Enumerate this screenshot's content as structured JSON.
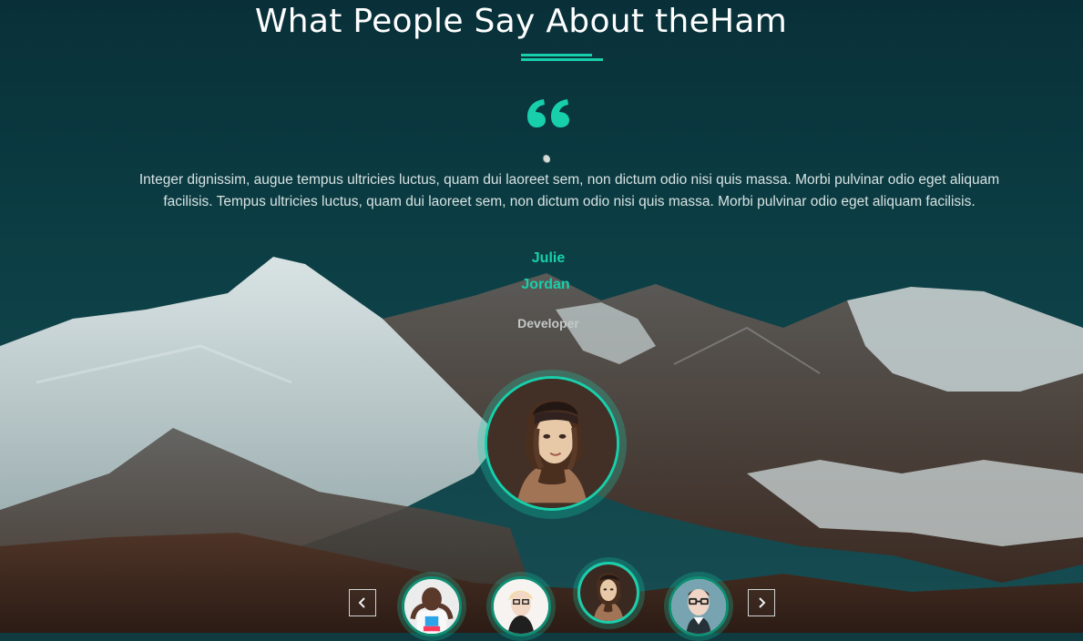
{
  "section": {
    "title": "What People Say About theHam",
    "quote_text_line1": "Integer dignissim, augue tempus ultricies luctus, quam dui laoreet sem, non dictum odio nisi quis massa. Morbi pulvinar odio eget aliquam",
    "quote_text_line2": "facilisis. Tempus ultricies luctus, quam dui laoreet sem, non dictum odio nisi quis massa. Morbi pulvinar odio eget aliquam facilisis."
  },
  "person": {
    "first_name": "Julie",
    "last_name": "Jordan",
    "role": "Developer"
  },
  "colors": {
    "accent": "#18cfab",
    "text_light": "#d7e3e3",
    "role_gray": "#c4c8c8"
  },
  "icons": {
    "quote": "quote-icon",
    "prev": "chevron-left-icon",
    "next": "chevron-right-icon"
  },
  "carousel": {
    "active_index": 2,
    "thumbnails": [
      "avatar-man-graphic-tee",
      "avatar-woman-blonde-glasses",
      "avatar-woman-beanie",
      "avatar-man-glasses"
    ]
  }
}
